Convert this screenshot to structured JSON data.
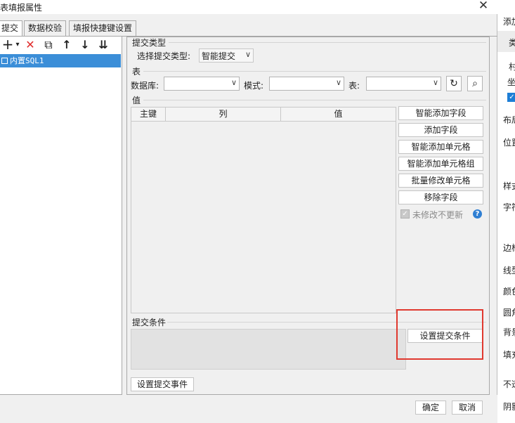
{
  "window": {
    "title": "报表填报属性",
    "close_glyph": "✕"
  },
  "tabs": [
    {
      "label": "提交",
      "active": true
    },
    {
      "label": "数据校验",
      "active": false
    },
    {
      "label": "填报快捷键设置",
      "active": false
    }
  ],
  "left_toolbar": {
    "add_glyph": "+",
    "add_dropdown_glyph": "▾",
    "delete_glyph": "✕",
    "copy_glyph": "⧉",
    "up_glyph": "↑",
    "down_glyph": "↓",
    "bottom_glyph": "⇊"
  },
  "tree": {
    "items": [
      {
        "label": "内置SQL1"
      }
    ]
  },
  "submit_type": {
    "section_label": "提交类型",
    "label": "选择提交类型:",
    "value": "智能提交",
    "arrow": "∨"
  },
  "table_section": {
    "section_label": "表",
    "database_label": "数据库:",
    "database_value": "",
    "mode_label": "模式:",
    "mode_value": "",
    "table_label": "表:",
    "table_value": "",
    "arrow": "∨",
    "refresh_glyph": "↻",
    "search_glyph": "⌕"
  },
  "value_section": {
    "section_label": "值",
    "columns": [
      "主键",
      "列",
      "值"
    ],
    "rows": []
  },
  "actions": [
    "智能添加字段",
    "添加字段",
    "智能添加单元格",
    "智能添加单元格组",
    "批量修改单元格",
    "移除字段"
  ],
  "no_update_checkbox": {
    "label": "未修改不更新",
    "checked": true,
    "check_glyph": "✓",
    "help_glyph": "?"
  },
  "submit_condition": {
    "section_label": "提交条件",
    "button": "设置提交条件"
  },
  "submit_event_button": "设置提交事件",
  "footer": {
    "ok": "确定",
    "cancel": "取消"
  },
  "background_panel": {
    "labels": [
      "添加",
      "类",
      "村",
      "坐",
      "布局",
      "位置",
      "样式",
      "字符",
      "边框",
      "线型",
      "颜色",
      "圆角",
      "背景",
      "填充",
      "不透",
      "阴影"
    ],
    "checkbox_glyph": "✓"
  },
  "colors": {
    "accent": "#3b8ed8",
    "highlight_box": "#e0392f",
    "help_icon": "#2f7fd3"
  }
}
